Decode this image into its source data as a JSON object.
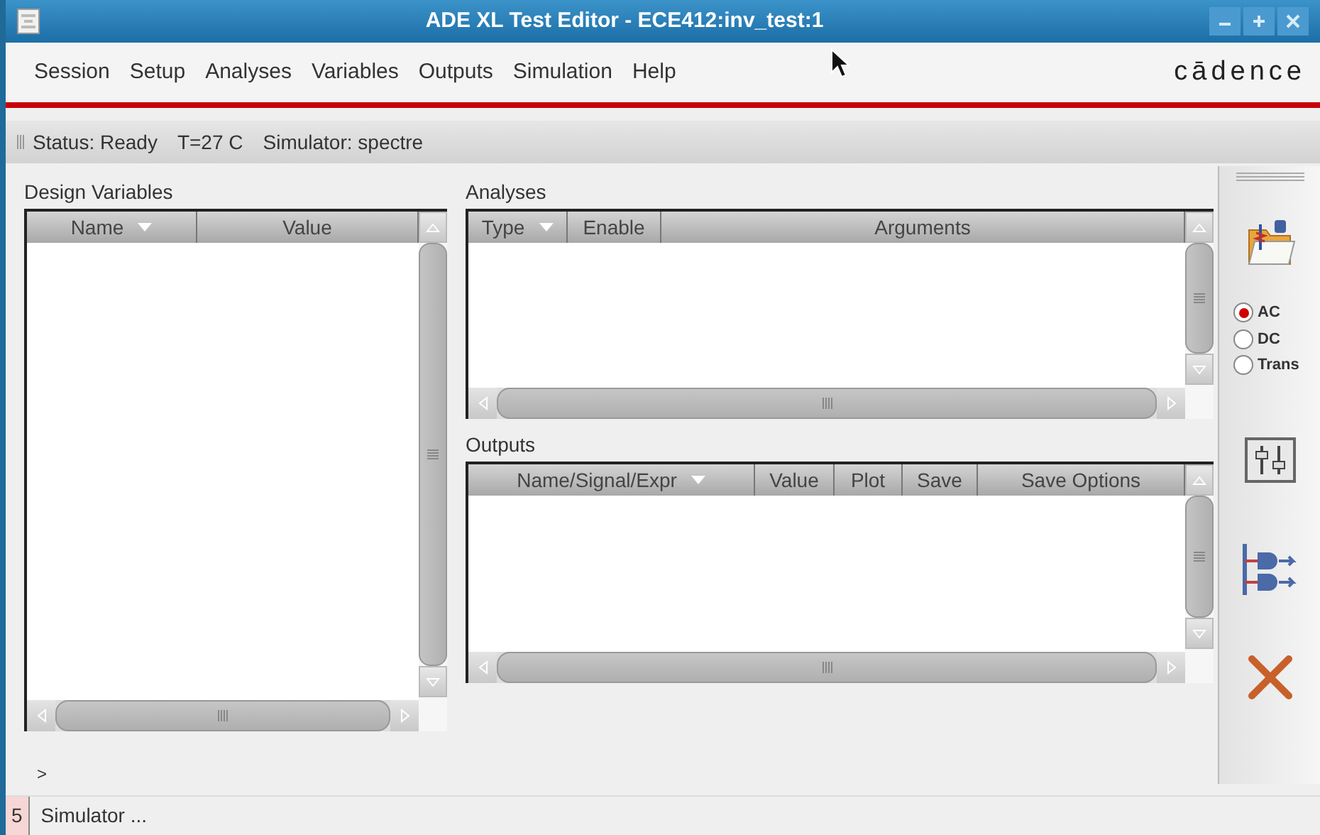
{
  "window": {
    "title": "ADE XL Test Editor - ECE412:inv_test:1"
  },
  "menu": [
    {
      "label": "Session"
    },
    {
      "label": "Setup"
    },
    {
      "label": "Analyses"
    },
    {
      "label": "Variables"
    },
    {
      "label": "Outputs"
    },
    {
      "label": "Simulation"
    },
    {
      "label": "Help"
    }
  ],
  "logo": "cādence",
  "status_bar": {
    "status": "Status: Ready",
    "temperature": "T=27 C",
    "simulator": "Simulator: spectre"
  },
  "design_variables": {
    "title": "Design Variables",
    "columns": [
      {
        "label": "Name",
        "sorted": true
      },
      {
        "label": "Value",
        "sorted": false
      }
    ]
  },
  "analyses": {
    "title": "Analyses",
    "columns": [
      {
        "label": "Type",
        "sorted": true
      },
      {
        "label": "Enable",
        "sorted": false
      },
      {
        "label": "Arguments",
        "sorted": false
      }
    ]
  },
  "outputs": {
    "title": "Outputs",
    "columns": [
      {
        "label": "Name/Signal/Expr",
        "sorted": true
      },
      {
        "label": "Value",
        "sorted": false
      },
      {
        "label": "Plot",
        "sorted": false
      },
      {
        "label": "Save",
        "sorted": false
      },
      {
        "label": "Save Options",
        "sorted": false
      }
    ]
  },
  "toolbar": {
    "analysis_types": [
      {
        "label": "AC",
        "selected": true
      },
      {
        "label": "DC",
        "selected": false
      },
      {
        "label": "Trans",
        "selected": false
      }
    ]
  },
  "command_prompt": ">",
  "message_bar": {
    "count": "5",
    "text": "Simulator ..."
  }
}
